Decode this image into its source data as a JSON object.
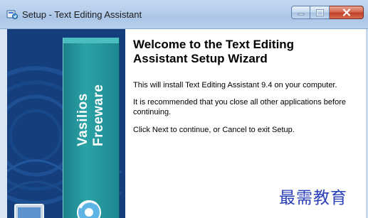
{
  "window": {
    "title": "Setup - Text Editing Assistant",
    "icons": {
      "app": "setup-app-icon",
      "minimize": "minimize-icon",
      "maximize": "maximize-icon",
      "close": "close-icon"
    }
  },
  "banner": {
    "vendor_line1": "Vasilios",
    "vendor_line2": "Freeware"
  },
  "main": {
    "heading": "Welcome to the Text Editing Assistant Setup Wizard",
    "paragraph1": "This will install Text Editing Assistant 9.4 on your computer.",
    "paragraph2": "It is recommended that you close all other applications before continuing.",
    "paragraph3": "Click Next to continue, or Cancel to exit Setup."
  },
  "watermark": "最需教育",
  "colors": {
    "banner_background": "#143f7c",
    "banner_band": "#2aa3a6",
    "watermark": "#2a3fb8"
  }
}
